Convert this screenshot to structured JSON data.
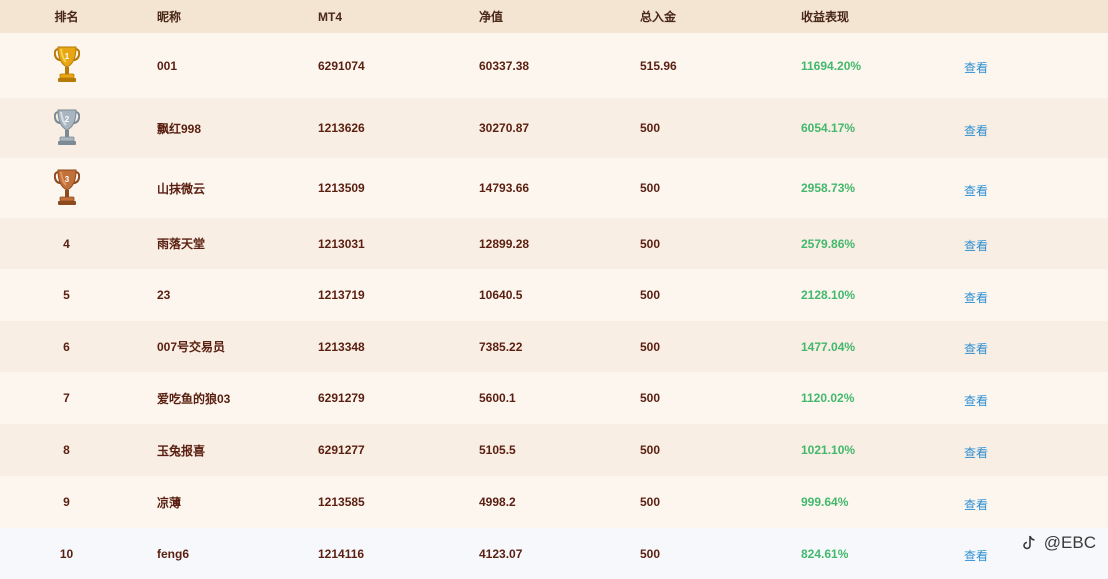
{
  "headers": {
    "rank": "排名",
    "nickname": "昵称",
    "mt4": "MT4",
    "equity": "净值",
    "deposit": "总入金",
    "performance": "收益表现"
  },
  "rows": [
    {
      "rank": "1",
      "nickname": "001",
      "mt4": "6291074",
      "equity": "60337.38",
      "deposit": "515.96",
      "performance": "11694.20%",
      "view": "查看"
    },
    {
      "rank": "2",
      "nickname": "飘红998",
      "mt4": "1213626",
      "equity": "30270.87",
      "deposit": "500",
      "performance": "6054.17%",
      "view": "查看"
    },
    {
      "rank": "3",
      "nickname": "山抹微云",
      "mt4": "1213509",
      "equity": "14793.66",
      "deposit": "500",
      "performance": "2958.73%",
      "view": "查看"
    },
    {
      "rank": "4",
      "nickname": "雨落天堂",
      "mt4": "1213031",
      "equity": "12899.28",
      "deposit": "500",
      "performance": "2579.86%",
      "view": "查看"
    },
    {
      "rank": "5",
      "nickname": "23",
      "mt4": "1213719",
      "equity": "10640.5",
      "deposit": "500",
      "performance": "2128.10%",
      "view": "查看"
    },
    {
      "rank": "6",
      "nickname": "007号交易员",
      "mt4": "1213348",
      "equity": "7385.22",
      "deposit": "500",
      "performance": "1477.04%",
      "view": "查看"
    },
    {
      "rank": "7",
      "nickname": "爱吃鱼的狼03",
      "mt4": "6291279",
      "equity": "5600.1",
      "deposit": "500",
      "performance": "1120.02%",
      "view": "查看"
    },
    {
      "rank": "8",
      "nickname": "玉兔报喜",
      "mt4": "6291277",
      "equity": "5105.5",
      "deposit": "500",
      "performance": "1021.10%",
      "view": "查看"
    },
    {
      "rank": "9",
      "nickname": "凉薄",
      "mt4": "1213585",
      "equity": "4998.2",
      "deposit": "500",
      "performance": "999.64%",
      "view": "查看"
    },
    {
      "rank": "10",
      "nickname": "feng6",
      "mt4": "1214116",
      "equity": "4123.07",
      "deposit": "500",
      "performance": "824.61%",
      "view": "查看"
    }
  ],
  "icons": {
    "gold": "gold-trophy-icon",
    "silver": "silver-trophy-icon",
    "bronze": "bronze-trophy-icon",
    "watermark": "tiktok-logo-icon"
  },
  "colors": {
    "performance": "#43b86c",
    "link": "#2e8fd3",
    "text": "#5a1f10",
    "header_bg": "#f4e4d2"
  },
  "watermark": {
    "text": "@EBC"
  }
}
